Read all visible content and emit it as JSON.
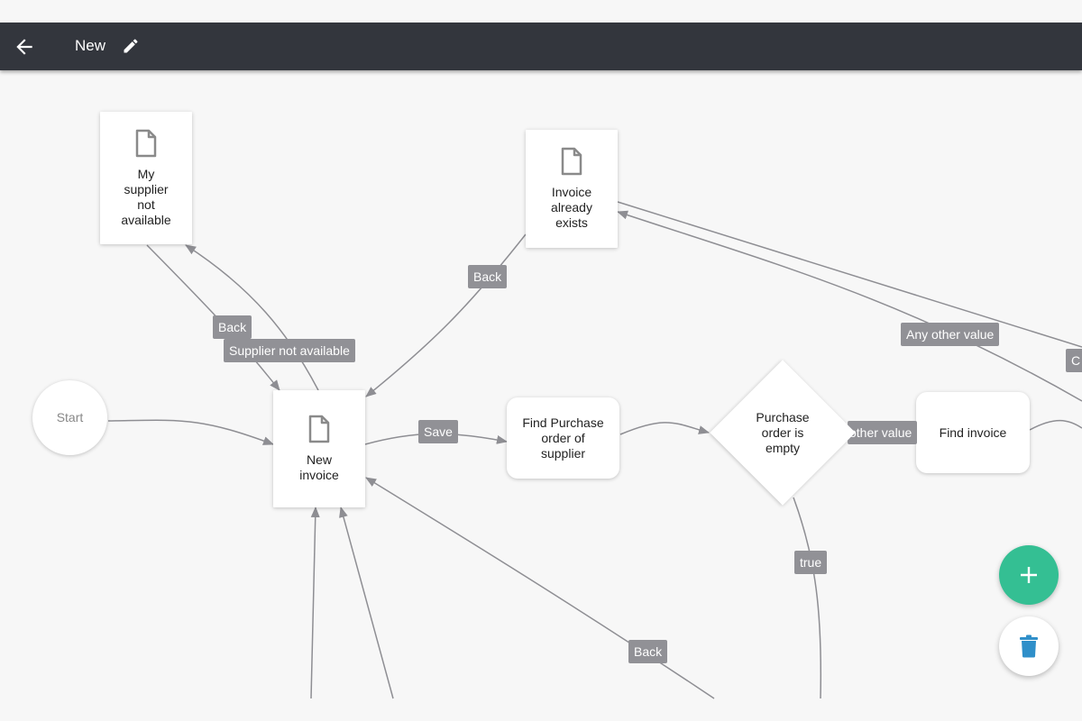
{
  "header": {
    "title": "New",
    "back_icon": "arrow-left-icon",
    "edit_icon": "pencil-icon"
  },
  "colors": {
    "toolbar_bg": "#33363d",
    "canvas_bg": "#f7f7f7",
    "edge": "#8e8e93",
    "edge_label_bg": "#919196",
    "fab_add": "#34bf93",
    "fab_delete_icon": "#2f8fc9"
  },
  "nodes": {
    "start": {
      "label": "Start",
      "shape": "circle"
    },
    "my_supplier": {
      "label": "My supplier not available",
      "lines": [
        "My",
        "supplier",
        "not",
        "available"
      ],
      "icon": "document-icon"
    },
    "invoice_exists": {
      "label": "Invoice already exists",
      "lines": [
        "Invoice",
        "already",
        "exists"
      ],
      "icon": "document-icon"
    },
    "new_invoice": {
      "label": "New invoice",
      "lines": [
        "New",
        "invoice"
      ],
      "icon": "document-icon"
    },
    "find_po": {
      "label": "Find Purchase order of supplier",
      "lines": [
        "Find Purchase",
        "order of",
        "supplier"
      ]
    },
    "po_empty": {
      "label": "Purchase order is empty",
      "lines": [
        "Purchase",
        "order is",
        "empty"
      ],
      "shape": "diamond"
    },
    "find_invoice": {
      "label": "Find invoice"
    }
  },
  "edge_labels": {
    "back_1": "Back",
    "supplier_not_available": "Supplier not available",
    "back_2": "Back",
    "save": "Save",
    "any_other_value_1": "Any other value",
    "any_other_value_2": "other value",
    "true": "true",
    "back_3": "Back",
    "cut_off": "C"
  },
  "actions": {
    "add_icon": "plus-icon",
    "delete_icon": "trash-icon"
  }
}
